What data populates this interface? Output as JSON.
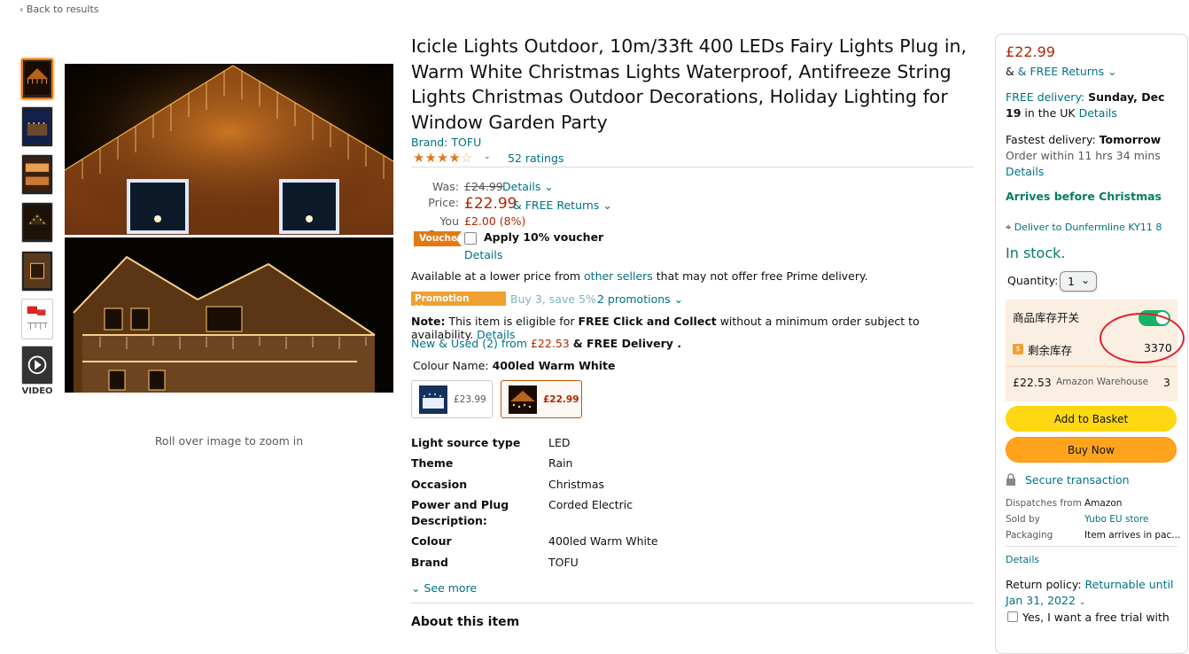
{
  "nav": {
    "back": "‹ Back to results"
  },
  "gallery": {
    "zoom_hint": "Roll over image to zoom in",
    "video_label": "VIDEO"
  },
  "product": {
    "title": "Icicle Lights Outdoor, 10m/33ft 400 LEDs Fairy Lights Plug in, Warm White Christmas Lights Waterproof, Antifreeze String Lights Christmas Outdoor Decorations, Holiday Lighting for Window Garden Party",
    "brand": "Brand: TOFU",
    "stars": "★★★★☆",
    "stars_filled": "★★★★",
    "stars_empty": "☆",
    "ratings": "52 ratings",
    "was_label": "Was:",
    "was_value": "£24.99",
    "was_details": "Details ⌄",
    "price_label": "Price:",
    "price_value": "£22.99",
    "price_returns": "& FREE Returns ⌄",
    "save_label": "You Save:",
    "save_value": "£2.00 (8%)",
    "voucher_badge": "Voucher",
    "voucher_text": "Apply 10% voucher",
    "voucher_details": "Details",
    "lower_price_pre": "Available at a lower price from ",
    "lower_price_link": "other sellers",
    "lower_price_post": " that may not offer free Prime delivery.",
    "promo_badge": "Promotion Message",
    "promo_text": "Buy 3, save 5%.",
    "promo_link": "2 promotions ⌄",
    "note_label": "Note:",
    "note_text_1": " This item is eligible for ",
    "note_bold": "FREE Click and Collect",
    "note_text_2": " without a minimum order subject to availability. ",
    "note_link": "Details",
    "new_used_link": "New & Used (2) from",
    "new_used_price": "£22.53",
    "new_used_post": "& FREE Delivery .",
    "colour_label": "Colour Name:",
    "colour_value": "400led Warm White",
    "swatches": [
      {
        "price": "£23.99"
      },
      {
        "price": "£22.99"
      }
    ],
    "see_more": "⌄ See more",
    "about": "About this item"
  },
  "specs": [
    {
      "k": "Light source type",
      "v": "LED"
    },
    {
      "k": "Theme",
      "v": "Rain"
    },
    {
      "k": "Occasion",
      "v": "Christmas"
    },
    {
      "k": "Power and Plug Description:",
      "v": "Corded Electric"
    },
    {
      "k": "Colour",
      "v": "400led Warm White"
    },
    {
      "k": "Brand",
      "v": "TOFU"
    }
  ],
  "buybox": {
    "price": "£22.99",
    "returns": "& FREE Returns ⌄",
    "delivery_label": "FREE delivery:",
    "delivery_date": "Sunday, Dec 19",
    "delivery_post": " in the UK ",
    "delivery_details": "Details",
    "fastest_label": "Fastest delivery: ",
    "fastest_date": "Tomorrow",
    "fastest_order": "Order within 11 hrs 34 mins",
    "fastest_details": "Details",
    "arrives": "Arrives before Christmas",
    "deliver_to": "Deliver to Dunfermline KY11 8",
    "stock": "In stock.",
    "quantity_label": "Quantity:",
    "quantity_value": "1",
    "inventory_switch": "商品库存开关",
    "inventory_remaining_label": "剩余库存",
    "inventory_remaining": "3370",
    "warehouse_price": "£22.53",
    "warehouse_name": "Amazon Warehouse",
    "warehouse_count": "3",
    "add_basket": "Add to Basket",
    "buy_now": "Buy Now",
    "secure": "Secure transaction",
    "dispatches_label": "Dispatches from",
    "dispatches_value": "Amazon",
    "sold_label": "Sold by",
    "sold_value": "Yubo EU store",
    "packaging_label": "Packaging",
    "packaging_value": "Item arrives in pac...",
    "details": "Details",
    "return_label": "Return policy: ",
    "return_link": "Returnable until Jan 31, 2022",
    "trial": "Yes, I want a free trial with"
  },
  "colors": {
    "accent": "#007185",
    "price": "#b12704",
    "in_stock": "#067d62",
    "basket_button": "#ffd814",
    "buy_button": "#ffa41c",
    "toggle_on": "#17b26a",
    "annotation_circle": "#e0222b"
  }
}
